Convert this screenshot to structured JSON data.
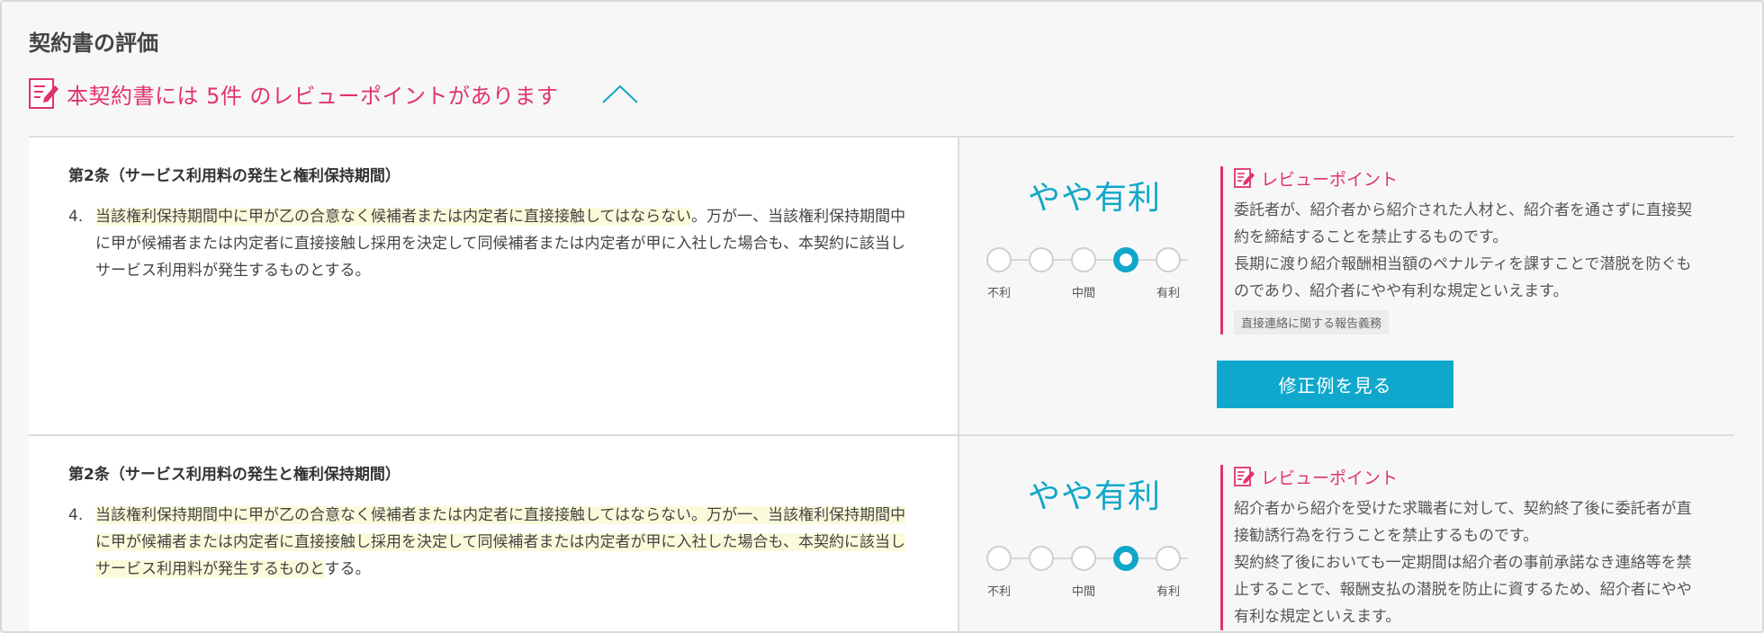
{
  "page": {
    "title": "契約書の評価",
    "summary": "本契約書には 5件 のレビューポイントがあります",
    "accent_color": "#e0336e",
    "primary_color": "#11a7c9"
  },
  "items": [
    {
      "clause_title": "第2条（サービス利用料の発生と権利保持期間）",
      "clause_num": "4.",
      "clause_highlight": "当該権利保持期間中に甲が乙の合意なく候補者または内定者に直接接触してはならない",
      "clause_rest": "。万が一、当該権利保持期間中に甲が候補者または内定者に直接接触し採用を決定して同候補者または内定者が甲に入社した場合も、本契約に該当しサービス利用料が発生するものとする。",
      "rating": "やや有利",
      "rating_level": 4,
      "scale_labels": {
        "min": "不利",
        "mid": "中間",
        "max": "有利"
      },
      "review_title": "レビューポイント",
      "review_text": [
        "委託者が、紹介者から紹介された人材と、紹介者を通さずに直接契約を締結することを禁止するものです。",
        "長期に渡り紹介報酬相当額のペナルティを課すことで潜脱を防ぐものであり、紹介者にやや有利な規定といえます。"
      ],
      "tag": "直接連絡に関する報告義務",
      "button_label": "修正例を見る"
    },
    {
      "clause_title": "第2条（サービス利用料の発生と権利保持期間）",
      "clause_num": "4.",
      "clause_highlight": "当該権利保持期間中に甲が乙の合意なく候補者または内定者に直接接触してはならない。万が一、当該権利保持期間中に甲が候補者または内定者に直接接触し採用を決定して同候補者または内定者が甲に入社した場合も、本契約に該当しサービス利用料が発生するものと",
      "clause_rest": "する。",
      "rating": "やや有利",
      "rating_level": 4,
      "scale_labels": {
        "min": "不利",
        "mid": "中間",
        "max": "有利"
      },
      "review_title": "レビューポイント",
      "review_text": [
        "紹介者から紹介を受けた求職者に対して、契約終了後に委託者が直接勧誘行為を行うことを禁止するものです。",
        "契約終了後においても一定期間は紹介者の事前承諾なき連絡等を禁止することで、報酬支払の潜脱を防止に資するため、紹介者にやや有利な規定といえます。"
      ]
    }
  ]
}
